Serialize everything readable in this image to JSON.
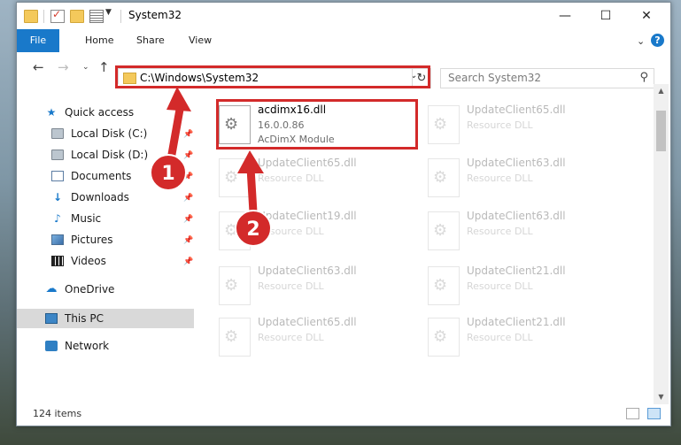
{
  "window": {
    "title": "System32"
  },
  "window_controls": {
    "minimize": "—",
    "maximize": "☐",
    "close": "✕"
  },
  "ribbon": {
    "tabs": [
      "File",
      "Home",
      "Share",
      "View"
    ],
    "help": "?"
  },
  "address_bar": {
    "path": "C:\\Windows\\System32"
  },
  "search": {
    "placeholder": "Search System32"
  },
  "sidebar": {
    "quick_access": "Quick access",
    "items": [
      {
        "label": "Local Disk (C:)",
        "icon": "drive-icon",
        "pinned": true
      },
      {
        "label": "Local Disk (D:)",
        "icon": "drive-icon",
        "pinned": true
      },
      {
        "label": "Documents",
        "icon": "documents-icon",
        "pinned": true
      },
      {
        "label": "Downloads",
        "icon": "downloads-icon",
        "pinned": true
      },
      {
        "label": "Music",
        "icon": "music-icon",
        "pinned": true
      },
      {
        "label": "Pictures",
        "icon": "pictures-icon",
        "pinned": true
      },
      {
        "label": "Videos",
        "icon": "videos-icon",
        "pinned": true
      }
    ],
    "onedrive": "OneDrive",
    "this_pc": "This PC",
    "network": "Network"
  },
  "files": {
    "highlighted": {
      "name": "acdimx16.dll",
      "version": "16.0.0.86",
      "description": "AcDimX Module"
    },
    "background": [
      {
        "name": "UpdateClient65.dll",
        "description": "Resource DLL"
      },
      {
        "name": "UpdateClient65.dll",
        "description": "Resource DLL"
      },
      {
        "name": "UpdateClient63.dll",
        "description": "Resource DLL"
      },
      {
        "name": "UpdateClient19.dll",
        "description": "Resource DLL"
      },
      {
        "name": "UpdateClient63.dll",
        "description": "Resource DLL"
      },
      {
        "name": "UpdateClient63.dll",
        "description": "Resource DLL"
      },
      {
        "name": "UpdateClient21.dll",
        "description": "Resource DLL"
      },
      {
        "name": "UpdateClient65.dll",
        "description": "Resource DLL"
      },
      {
        "name": "UpdateClient21.dll",
        "description": "Resource DLL"
      }
    ]
  },
  "status": {
    "item_count": "124 items"
  },
  "annotations": {
    "step1": "1",
    "step2": "2",
    "color": "#d32a2a"
  }
}
